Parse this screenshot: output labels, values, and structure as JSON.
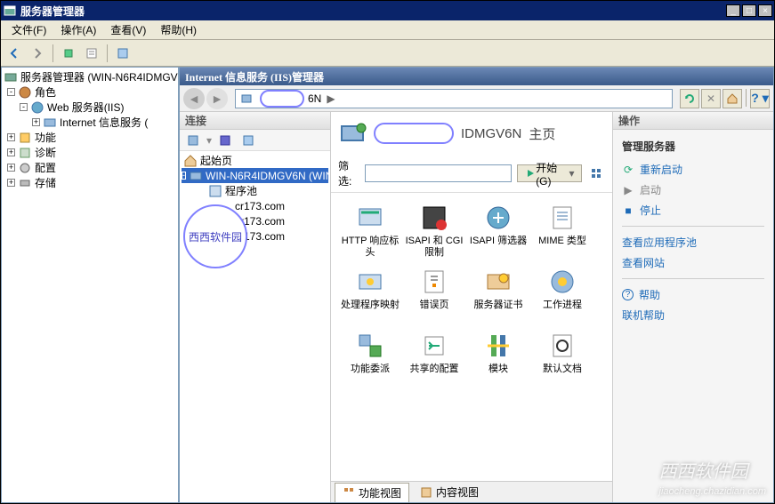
{
  "window": {
    "title": "服务器管理器",
    "min": "_",
    "max": "□",
    "close": "×"
  },
  "menubar": {
    "file": "文件(F)",
    "action": "操作(A)",
    "view": "查看(V)",
    "help": "帮助(H)"
  },
  "left_tree": {
    "root": "服务器管理器 (WIN-N6R4IDMGV6",
    "roles": "角色",
    "web_server": "Web 服务器(IIS)",
    "iis": "Internet 信息服务 (",
    "features": "功能",
    "diag": "诊断",
    "config": "配置",
    "storage": "存储"
  },
  "iis": {
    "title": "Internet 信息服务 (IIS)管理器",
    "breadcrumb_server": "6N",
    "breadcrumb_arrow": "▶"
  },
  "conn": {
    "header": "连接",
    "start_page": "起始页",
    "server": "WIN-N6R4IDMGV6N (WIN",
    "app_pools_frag": "程序池",
    "site1": "cr173.com",
    "site2": "r173.com",
    "site3": "cr173.com",
    "cloud_text": "西西软件园"
  },
  "center": {
    "title_server_frag": "IDMGV6N",
    "title_suffix": "主页",
    "filter_label": "筛选:",
    "filter_placeholder": "",
    "start_btn": "开始(G)",
    "features": [
      {
        "label": "HTTP 响应标头"
      },
      {
        "label": "ISAPI 和 CGI 限制"
      },
      {
        "label": "ISAPI 筛选器"
      },
      {
        "label": "MIME 类型"
      },
      {
        "label": "处理程序映射"
      },
      {
        "label": "错误页"
      },
      {
        "label": "服务器证书"
      },
      {
        "label": "工作进程"
      },
      {
        "label": "功能委派"
      },
      {
        "label": "共享的配置"
      },
      {
        "label": "模块"
      },
      {
        "label": "默认文档"
      }
    ],
    "tab_features": "功能视图",
    "tab_content": "内容视图"
  },
  "actions": {
    "header": "操作",
    "manage_server": "管理服务器",
    "restart": "重新启动",
    "start": "启动",
    "stop": "停止",
    "view_app_pools": "查看应用程序池",
    "view_sites": "查看网站",
    "help": "帮助",
    "online_help": "联机帮助"
  },
  "watermark_host": "jiaocheng.chazidian.com"
}
